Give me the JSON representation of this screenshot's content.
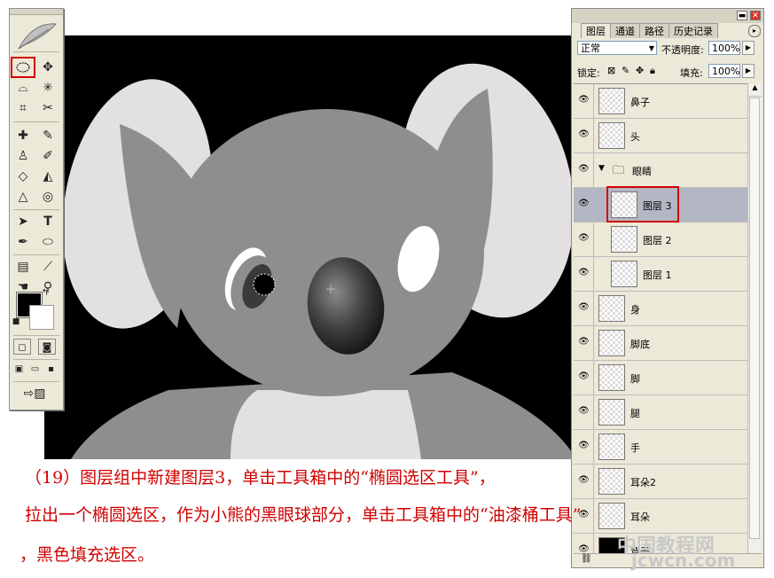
{
  "layers_panel": {
    "tabs": [
      "图层",
      "通道",
      "路径",
      "历史记录"
    ],
    "blend_mode": "正常",
    "opacity_label": "不透明度:",
    "opacity_value": "100%",
    "lock_label": "锁定:",
    "fill_label": "填充:",
    "fill_value": "100%",
    "layers": [
      {
        "name": "鼻子"
      },
      {
        "name": "头"
      },
      {
        "name": "眼睛"
      },
      {
        "name": "图层 3"
      },
      {
        "name": "图层 2"
      },
      {
        "name": "图层 1"
      },
      {
        "name": "身"
      },
      {
        "name": "脚底"
      },
      {
        "name": "脚"
      },
      {
        "name": "腿"
      },
      {
        "name": "手"
      },
      {
        "name": "耳朵2"
      },
      {
        "name": "耳朵"
      },
      {
        "name": "背景"
      }
    ]
  },
  "caption": {
    "line1": "（19）图层组中新建图层3，单击工具箱中的“椭圆选区工具”，",
    "line2": "拉出一个椭圆选区，作为小熊的黑眼球部分，单击工具箱中的“油漆桶工具”",
    "line3": "，黑色填充选区。"
  },
  "watermark": {
    "line1": "中国教程网",
    "line2": "jcwcn.com"
  },
  "colors": {
    "canvas_bg": "#000000",
    "koala_body": "#8e8e8e",
    "koala_light": "#e2e0e3",
    "caption": "#d00000",
    "highlight": "#d40000"
  }
}
